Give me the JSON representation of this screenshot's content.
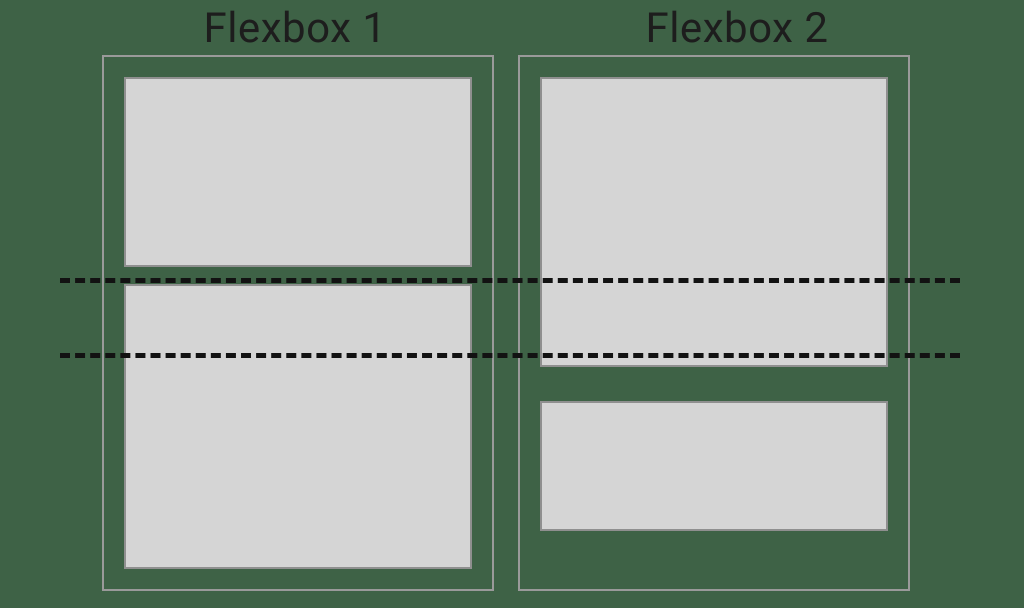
{
  "labels": {
    "flexbox1": "Flexbox 1",
    "flexbox2": "Flexbox 2"
  }
}
